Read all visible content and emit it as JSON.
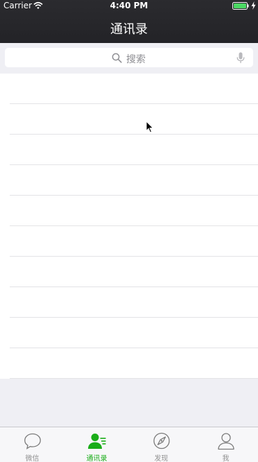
{
  "status_bar": {
    "carrier": "Carrier",
    "time": "4:40 PM"
  },
  "navbar": {
    "title": "通讯录"
  },
  "search": {
    "placeholder": "搜索"
  },
  "contacts": {
    "rows": [
      "",
      "",
      "",
      "",
      "",
      "",
      "",
      "",
      "",
      ""
    ]
  },
  "tab_bar": {
    "tabs": [
      {
        "label": "微信",
        "icon": "chat-bubble-icon",
        "active": false
      },
      {
        "label": "通讯录",
        "icon": "contacts-icon",
        "active": true
      },
      {
        "label": "发现",
        "icon": "compass-icon",
        "active": false
      },
      {
        "label": "我",
        "icon": "person-icon",
        "active": false
      }
    ]
  },
  "colors": {
    "accent": "#1aad19",
    "navbar": "#2a2a2e",
    "inactive_tab": "#929292",
    "background": "#efeff4"
  }
}
